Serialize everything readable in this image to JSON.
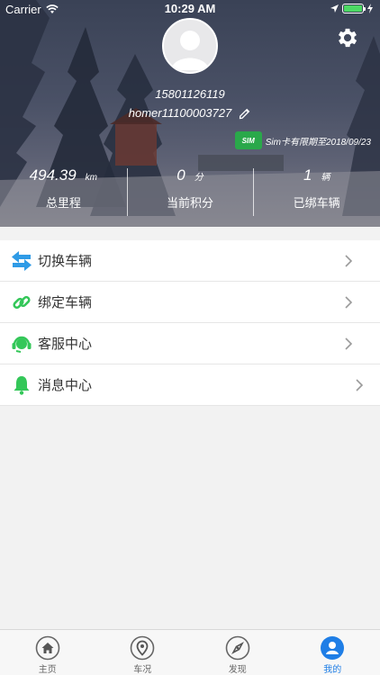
{
  "status_bar": {
    "carrier": "Carrier",
    "time": "10:29 AM"
  },
  "profile": {
    "phone": "15801126119",
    "username": "homer11100003727",
    "sim": {
      "badge": "SIM",
      "text": "Sim卡有限期至2018/09/23"
    }
  },
  "stats": [
    {
      "value": "494.39",
      "unit": "km",
      "label": "总里程"
    },
    {
      "value": "0",
      "unit": "分",
      "label": "当前积分"
    },
    {
      "value": "1",
      "unit": "辆",
      "label": "已绑车辆"
    }
  ],
  "menu": [
    {
      "label": "切换车辆",
      "icon": "swap-icon"
    },
    {
      "label": "绑定车辆",
      "icon": "link-icon"
    },
    {
      "label": "客服中心",
      "icon": "headset-icon"
    },
    {
      "label": "消息中心",
      "icon": "bell-icon"
    }
  ],
  "tabs": [
    {
      "label": "主页",
      "icon": "home-icon"
    },
    {
      "label": "车况",
      "icon": "location-pin-icon"
    },
    {
      "label": "发现",
      "icon": "compass-icon"
    },
    {
      "label": "我的",
      "icon": "user-icon",
      "active": true
    }
  ],
  "colors": {
    "accent": "#1f7ee6",
    "menu_icon_blue": "#2f9be6",
    "menu_icon_green": "#34c759",
    "sim_green": "#2aa84a"
  }
}
